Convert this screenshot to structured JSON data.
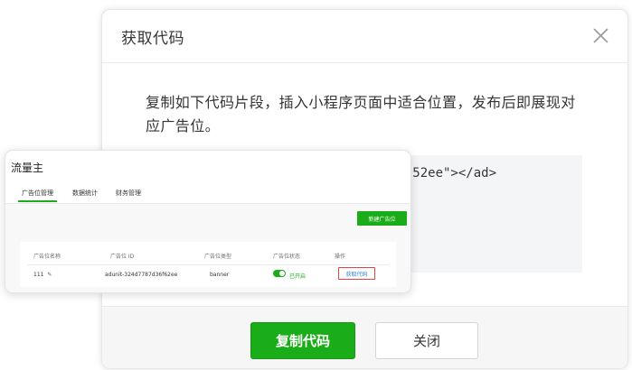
{
  "modal": {
    "title": "获取代码",
    "instruction": "复制如下代码片段，插入小程序页面中适合位置，发布后即展现对应广告位。",
    "code_visible": "52ee\"></ad>",
    "copy_button": "复制代码",
    "close_button": "关闭"
  },
  "panel": {
    "title": "流量主",
    "tabs": [
      {
        "label": "广告位管理",
        "active": true
      },
      {
        "label": "数据统计",
        "active": false
      },
      {
        "label": "财务管理",
        "active": false
      }
    ],
    "new_button": "新建广告位",
    "table": {
      "headers": [
        "广告位名称",
        "广告位 ID",
        "广告位类型",
        "广告位状态",
        "操作"
      ],
      "rows": [
        {
          "name": "111",
          "id": "adunit-324d7787d36f62ee",
          "type": "banner",
          "status": "已开启",
          "status_on": true,
          "action": "获取代码"
        }
      ]
    }
  },
  "colors": {
    "primary_green": "#1aad19",
    "highlight_red": "#e64340",
    "link_blue": "#2f7fd8"
  }
}
